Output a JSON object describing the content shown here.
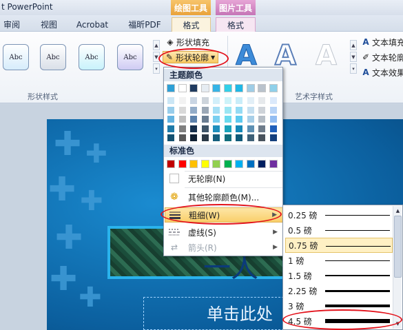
{
  "window": {
    "title": "t PowerPoint"
  },
  "context_groups": {
    "drawing_tools": "绘图工具",
    "picture_tools": "图片工具"
  },
  "tabs": [
    {
      "label": "审阅"
    },
    {
      "label": "视图"
    },
    {
      "label": "Acrobat"
    },
    {
      "label": "福昕PDF"
    },
    {
      "label": "格式",
      "active": true
    },
    {
      "label": "格式",
      "active": true
    }
  ],
  "ribbon": {
    "shape_styles": {
      "sample_text": "Abc",
      "group_label": "形状样式"
    },
    "shape_fill": "形状填充",
    "shape_outline": "形状轮廓",
    "wordart_group_label": "艺术字样式",
    "text_fill": "文本填充",
    "text_outline": "文本轮廓",
    "text_effects": "文本效果",
    "wordart_sample": "A"
  },
  "outline_menu": {
    "theme_colors_header": "主题颜色",
    "standard_colors_header": "标准色",
    "theme_colors_top": [
      "#2ea0d6",
      "#ffffff",
      "#1f3a5f",
      "#e6ecf2",
      "#36b4e6",
      "#32d0e8",
      "#1fb8e6",
      "#9fcde6",
      "#b9c2cc",
      "#8fd0ea"
    ],
    "theme_colors_shades": [
      [
        "#cbe6f5",
        "#f2f2f2",
        "#c9d5e3",
        "#cdd4db",
        "#d2effa",
        "#cdf3f9",
        "#c9edf9",
        "#e2eff7",
        "#e6e9ec",
        "#dbe9fb"
      ],
      [
        "#98cdeb",
        "#d9d9d9",
        "#93acc8",
        "#9ba8b6",
        "#a5dff5",
        "#9be6f3",
        "#94dbf4",
        "#c5dff0",
        "#ced3d9",
        "#b7d3f6"
      ],
      [
        "#65b4e1",
        "#bfbfbf",
        "#5d82ac",
        "#6a7d91",
        "#79cff0",
        "#6adaee",
        "#5ecaef",
        "#a8cfe8",
        "#b5bdc6",
        "#93bdf2"
      ],
      [
        "#1f7aa8",
        "#7f7f7f",
        "#17304d",
        "#3f5568",
        "#1f8fbd",
        "#1aa3ba",
        "#1588b7",
        "#5d90b3",
        "#6e7c8b",
        "#1f5fba"
      ],
      [
        "#145170",
        "#595959",
        "#0f2033",
        "#2a3845",
        "#155f7e",
        "#116d7c",
        "#0e5a79",
        "#3e6077",
        "#49535d",
        "#143f7c"
      ]
    ],
    "standard_colors": [
      "#c00000",
      "#ff0000",
      "#ffc000",
      "#ffff00",
      "#92d050",
      "#00b050",
      "#00b0f0",
      "#0070c0",
      "#002060",
      "#7030a0"
    ],
    "no_outline": "无轮廓(N)",
    "more_colors": "其他轮廓颜色(M)...",
    "weight": "粗细(W)",
    "dashes": "虚线(S)",
    "arrows": "箭头(R)"
  },
  "weight_submenu": {
    "items": [
      {
        "label": "0.25 磅",
        "thickness": 0.25
      },
      {
        "label": "0.5 磅",
        "thickness": 0.5
      },
      {
        "label": "0.75 磅",
        "thickness": 0.75
      },
      {
        "label": "1 磅",
        "thickness": 1
      },
      {
        "label": "1.5 磅",
        "thickness": 1.5
      },
      {
        "label": "2.25 磅",
        "thickness": 2.25
      },
      {
        "label": "3 磅",
        "thickness": 3
      },
      {
        "label": "4.5 磅",
        "thickness": 4.5
      }
    ]
  },
  "slide": {
    "subtitle_placeholder": "单击此处",
    "title_fragment": "一人"
  },
  "annotations": {
    "highlight_color": "#e3121b"
  }
}
